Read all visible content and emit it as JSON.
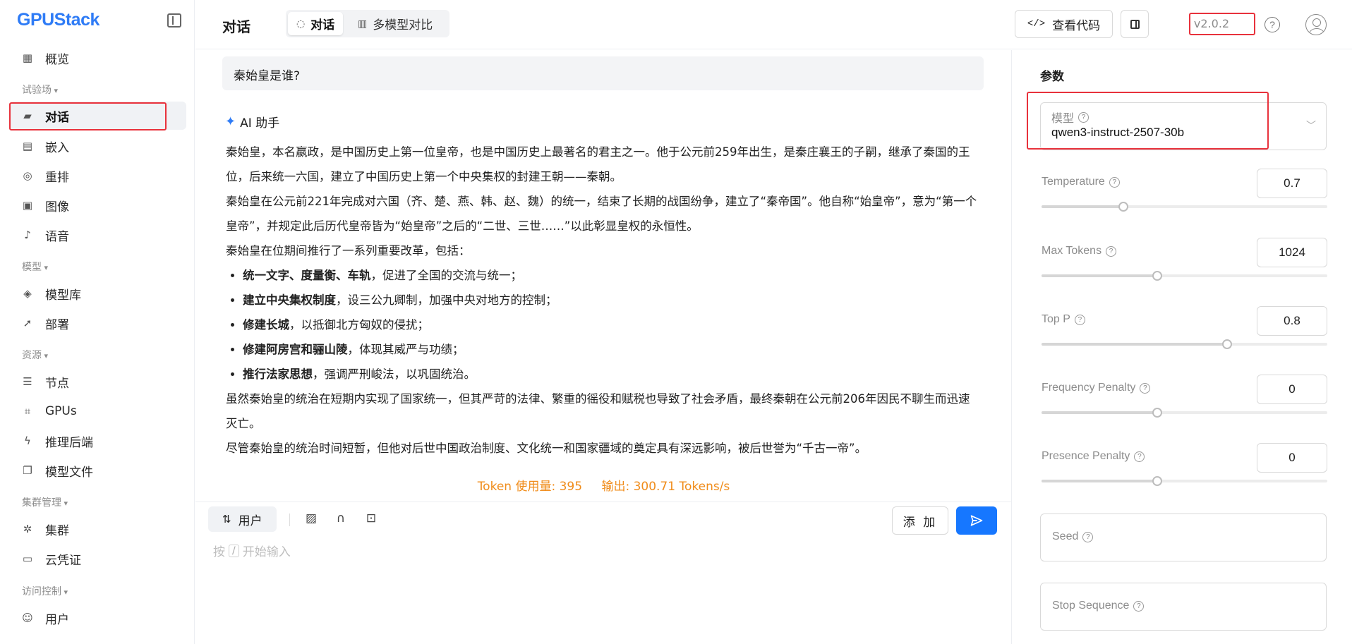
{
  "brand": {
    "logo": "GPUStack"
  },
  "sidebar": {
    "overview": "概览",
    "groups": {
      "playground": "试验场",
      "models": "模型",
      "resources": "资源",
      "cluster": "集群管理",
      "access": "访问控制"
    },
    "items": {
      "chat": "对话",
      "embed": "嵌入",
      "rerank": "重排",
      "image": "图像",
      "audio": "语音",
      "catalog": "模型库",
      "deploy": "部署",
      "nodes": "节点",
      "gpus": "GPUs",
      "backends": "推理后端",
      "model_files": "模型文件",
      "clusters": "集群",
      "credentials": "云凭证",
      "users": "用户"
    }
  },
  "header": {
    "title": "对话",
    "tabs": {
      "chat": "对话",
      "compare": "多模型对比"
    },
    "view_code": "查看代码",
    "version": "v2.0.2",
    "help_glyph": "?"
  },
  "chat": {
    "user_message": "秦始皇是谁?",
    "assistant_label": "AI 助手",
    "answer": {
      "p1": "秦始皇，本名嬴政，是中国历史上第一位皇帝，也是中国历史上最著名的君主之一。他于公元前259年出生，是秦庄襄王的子嗣，继承了秦国的王位，后来统一六国，建立了中国历史上第一个中央集权的封建王朝——秦朝。",
      "p2": "秦始皇在公元前221年完成对六国（齐、楚、燕、韩、赵、魏）的统一，结束了长期的战国纷争，建立了“秦帝国”。他自称“始皇帝”，意为“第一个皇帝”，并规定此后历代皇帝皆为“始皇帝”之后的“二世、三世……”以此彰显皇权的永恒性。",
      "p3": "秦始皇在位期间推行了一系列重要改革，包括：",
      "bullets": [
        {
          "bold": "统一文字、度量衡、车轨",
          "rest": "，促进了全国的交流与统一；"
        },
        {
          "bold": "建立中央集权制度",
          "rest": "，设三公九卿制，加强中央对地方的控制；"
        },
        {
          "bold": "修建长城",
          "rest": "，以抵御北方匈奴的侵扰；"
        },
        {
          "bold": "修建阿房宫和骊山陵",
          "rest": "，体现其威严与功绩；"
        },
        {
          "bold": "推行法家思想",
          "rest": "，强调严刑峻法，以巩固统治。"
        }
      ],
      "p4": "虽然秦始皇的统治在短期内实现了国家统一，但其严苛的法律、繁重的徭役和赋税也导致了社会矛盾，最终秦朝在公元前206年因民不聊生而迅速灭亡。",
      "p5": "尽管秦始皇的统治时间短暂，但他对后世中国政治制度、文化统一和国家疆域的奠定具有深远影响，被后世誉为“千古一帝”。"
    },
    "stats": {
      "tokens": "Token 使用量: 395",
      "speed": "输出: 300.71 Tokens/s"
    },
    "role_button": "用户",
    "add_button": "添 加",
    "placeholder": {
      "before": "按",
      "key": "/",
      "after": "开始输入"
    }
  },
  "params": {
    "title": "参数",
    "model_label": "模型",
    "model_value": "qwen3-instruct-2507-30b",
    "temperature": {
      "label": "Temperature",
      "value": "0.7",
      "level": 0.287
    },
    "max_tokens": {
      "label": "Max Tokens",
      "value": "1024",
      "level": 0.405
    },
    "top_p": {
      "label": "Top P",
      "value": "0.8",
      "level": 0.649
    },
    "frequency_penalty": {
      "label": "Frequency Penalty",
      "value": "0",
      "level": 0.405
    },
    "presence_penalty": {
      "label": "Presence Penalty",
      "value": "0",
      "level": 0.405
    },
    "seed": "Seed",
    "stop_sequence": "Stop Sequence"
  }
}
